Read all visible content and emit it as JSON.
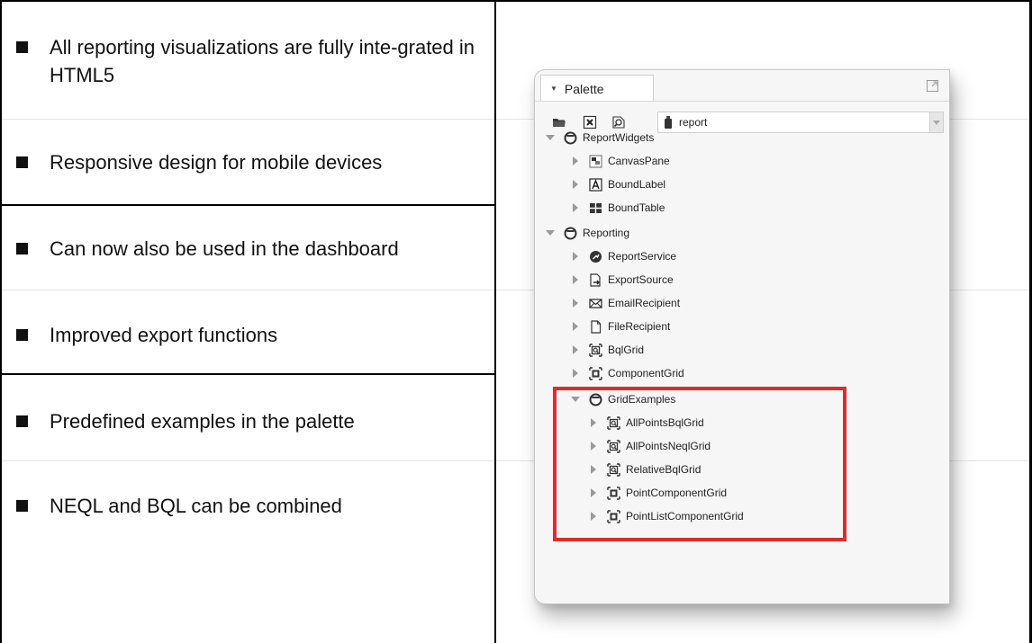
{
  "bullets": [
    {
      "text": "All reporting visualizations are fully inte-grated in HTML5"
    },
    {
      "text": "Responsive design for mobile devices"
    },
    {
      "text": "Can now also be used in the dashboard"
    },
    {
      "text": "Improved export functions"
    },
    {
      "text": "Predefined examples in the palette"
    },
    {
      "text": "NEQL and BQL can be combined"
    }
  ],
  "palette": {
    "tab_label": "Palette",
    "module_value": "report",
    "toolbar_icons": [
      "open-folder-icon",
      "close-x-icon",
      "find-icon"
    ],
    "tree": [
      {
        "label": "ReportWidgets",
        "icon": "folder-circle-icon",
        "expanded": true
      },
      {
        "label": "CanvasPane",
        "icon": "canvas-pane-icon"
      },
      {
        "label": "BoundLabel",
        "icon": "label-a-icon"
      },
      {
        "label": "BoundTable",
        "icon": "table-grid-icon"
      },
      {
        "label": "Reporting",
        "icon": "folder-circle-icon",
        "expanded": true
      },
      {
        "label": "ReportService",
        "icon": "report-service-icon"
      },
      {
        "label": "ExportSource",
        "icon": "export-source-icon"
      },
      {
        "label": "EmailRecipient",
        "icon": "envelope-icon"
      },
      {
        "label": "FileRecipient",
        "icon": "file-icon"
      },
      {
        "label": "BqlGrid",
        "icon": "bql-grid-icon"
      },
      {
        "label": "ComponentGrid",
        "icon": "component-grid-icon"
      },
      {
        "label": "GridExamples",
        "icon": "folder-circle-icon",
        "expanded": true
      },
      {
        "label": "AllPointsBqlGrid",
        "icon": "bql-grid-icon"
      },
      {
        "label": "AllPointsNeqlGrid",
        "icon": "bql-grid-icon"
      },
      {
        "label": "RelativeBqlGrid",
        "icon": "bql-grid-icon"
      },
      {
        "label": "PointComponentGrid",
        "icon": "component-grid-icon"
      },
      {
        "label": "PointListComponentGrid",
        "icon": "component-grid-icon"
      }
    ]
  },
  "colors": {
    "highlight": "#e02b2b",
    "panel_bg": "#f6f6f6",
    "tree_arrow": "#9a9a9a"
  }
}
